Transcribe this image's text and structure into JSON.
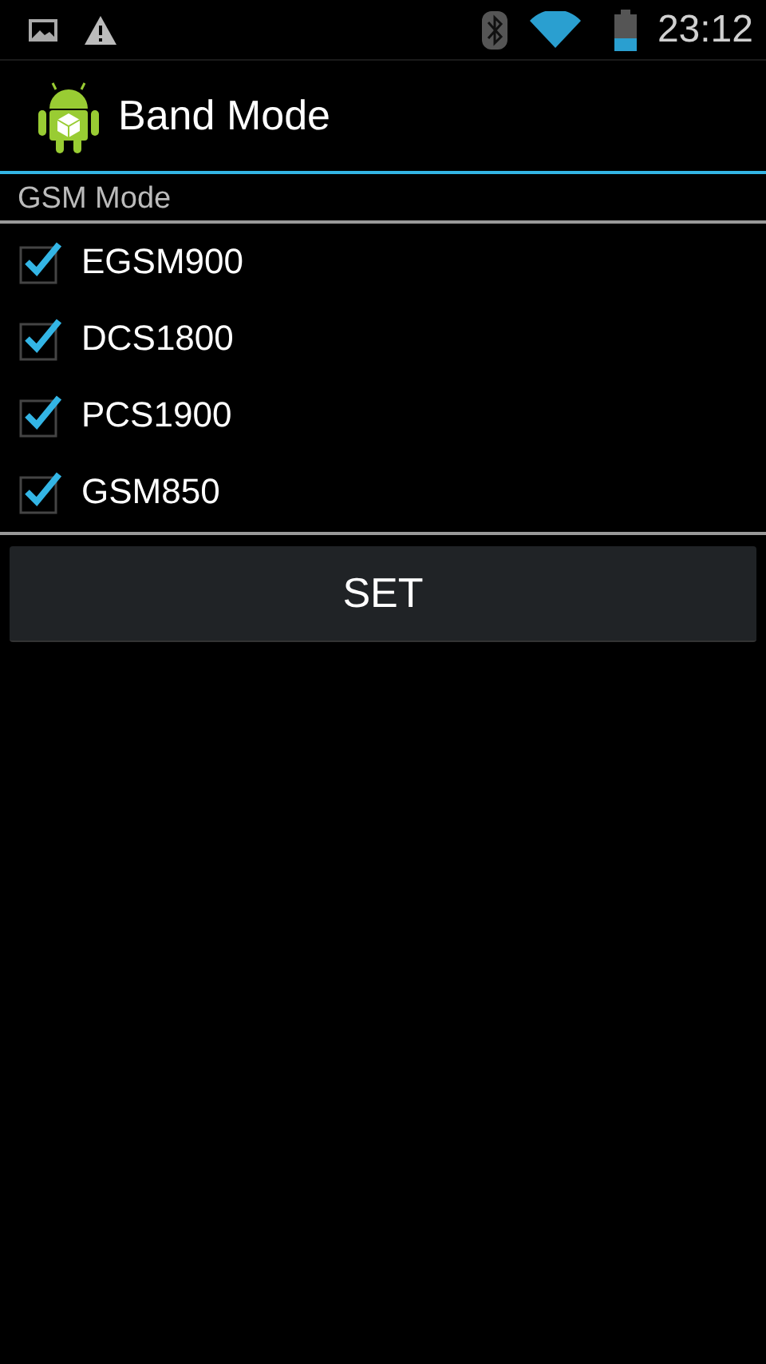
{
  "status_bar": {
    "time": "23:12"
  },
  "action_bar": {
    "title": "Band Mode"
  },
  "section": {
    "title": "GSM Mode"
  },
  "bands": [
    {
      "label": "EGSM900",
      "checked": true
    },
    {
      "label": "DCS1800",
      "checked": true
    },
    {
      "label": "PCS1900",
      "checked": true
    },
    {
      "label": "GSM850",
      "checked": true
    }
  ],
  "button": {
    "label": "SET"
  }
}
